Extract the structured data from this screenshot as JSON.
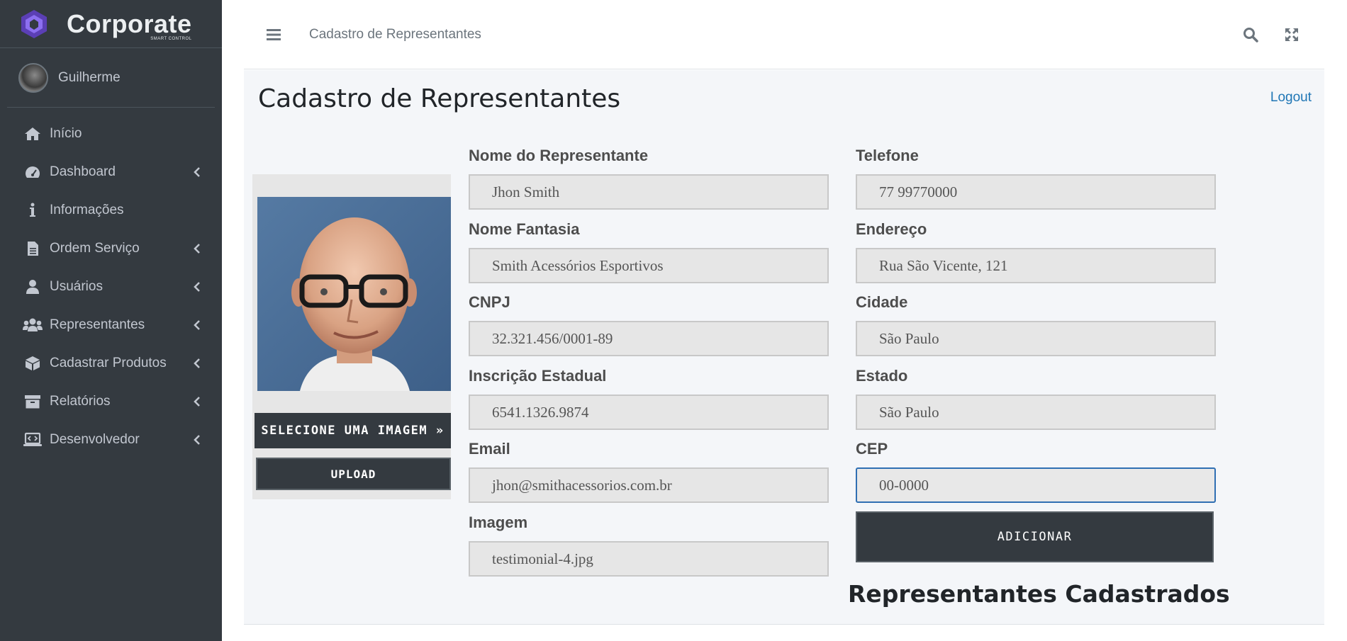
{
  "brand": {
    "name": "Corporate",
    "subtitle": "SMART CONTROL",
    "accent": "#6f42c1"
  },
  "user": {
    "name": "Guilherme"
  },
  "sidebar": {
    "items": [
      {
        "label": "Início",
        "icon": "home-icon",
        "has_caret": false
      },
      {
        "label": "Dashboard",
        "icon": "tachometer-icon",
        "has_caret": true
      },
      {
        "label": "Informações",
        "icon": "info-icon",
        "has_caret": false
      },
      {
        "label": "Ordem Serviço",
        "icon": "file-icon",
        "has_caret": true
      },
      {
        "label": "Usuários",
        "icon": "user-icon",
        "has_caret": true
      },
      {
        "label": "Representantes",
        "icon": "users-icon",
        "has_caret": true
      },
      {
        "label": "Cadastrar Produtos",
        "icon": "box-icon",
        "has_caret": true
      },
      {
        "label": "Relatórios",
        "icon": "archive-icon",
        "has_caret": true
      },
      {
        "label": "Desenvolvedor",
        "icon": "laptop-code-icon",
        "has_caret": true
      }
    ]
  },
  "topbar": {
    "title": "Cadastro de Representantes"
  },
  "page": {
    "title": "Cadastro de Representantes",
    "logout": "Logout"
  },
  "image_panel": {
    "select_label": "SELECIONE UMA IMAGEM »",
    "upload_label": "UPLOAD"
  },
  "form": {
    "nome_label": "Nome do Representante",
    "nome_value": "Jhon Smith",
    "fantasia_label": "Nome Fantasia",
    "fantasia_value": "Smith Acessórios Esportivos",
    "cnpj_label": "CNPJ",
    "cnpj_value": "32.321.456/0001-89",
    "ie_label": "Inscrição Estadual",
    "ie_value": "6541.1326.9874",
    "email_label": "Email",
    "email_value": "jhon@smithacessorios.com.br",
    "imagem_label": "Imagem",
    "imagem_value": "testimonial-4.jpg",
    "telefone_label": "Telefone",
    "telefone_value": "77 99770000",
    "endereco_label": "Endereço",
    "endereco_value": "Rua São Vicente, 121",
    "cidade_label": "Cidade",
    "cidade_value": "São Paulo",
    "estado_label": "Estado",
    "estado_value": "São Paulo",
    "cep_label": "CEP",
    "cep_value": "00-0000",
    "add_label": "ADICIONAR"
  },
  "list": {
    "title": "Representantes Cadastrados"
  }
}
